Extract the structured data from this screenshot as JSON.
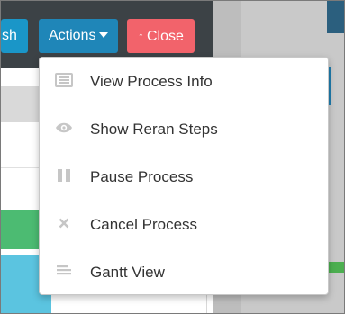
{
  "toolbar": {
    "refresh_label": "sh",
    "actions_label": "Actions",
    "close_label": "Close"
  },
  "actions_menu": {
    "items": [
      {
        "label": "View Process Info",
        "icon": "list-card-icon"
      },
      {
        "label": "Show Reran Steps",
        "icon": "eye-icon"
      },
      {
        "label": "Pause Process",
        "icon": "pause-icon"
      },
      {
        "label": "Cancel Process",
        "icon": "close-x-icon"
      },
      {
        "label": "Gantt View",
        "icon": "gantt-lines-icon"
      }
    ]
  },
  "colors": {
    "actions_button": "#1f86b8",
    "close_button": "#f2636b",
    "refresh_button": "#1a96c8",
    "toolbar_bg": "#3c4246",
    "menu_icon": "#c6c6c6",
    "menu_text": "#333333"
  }
}
